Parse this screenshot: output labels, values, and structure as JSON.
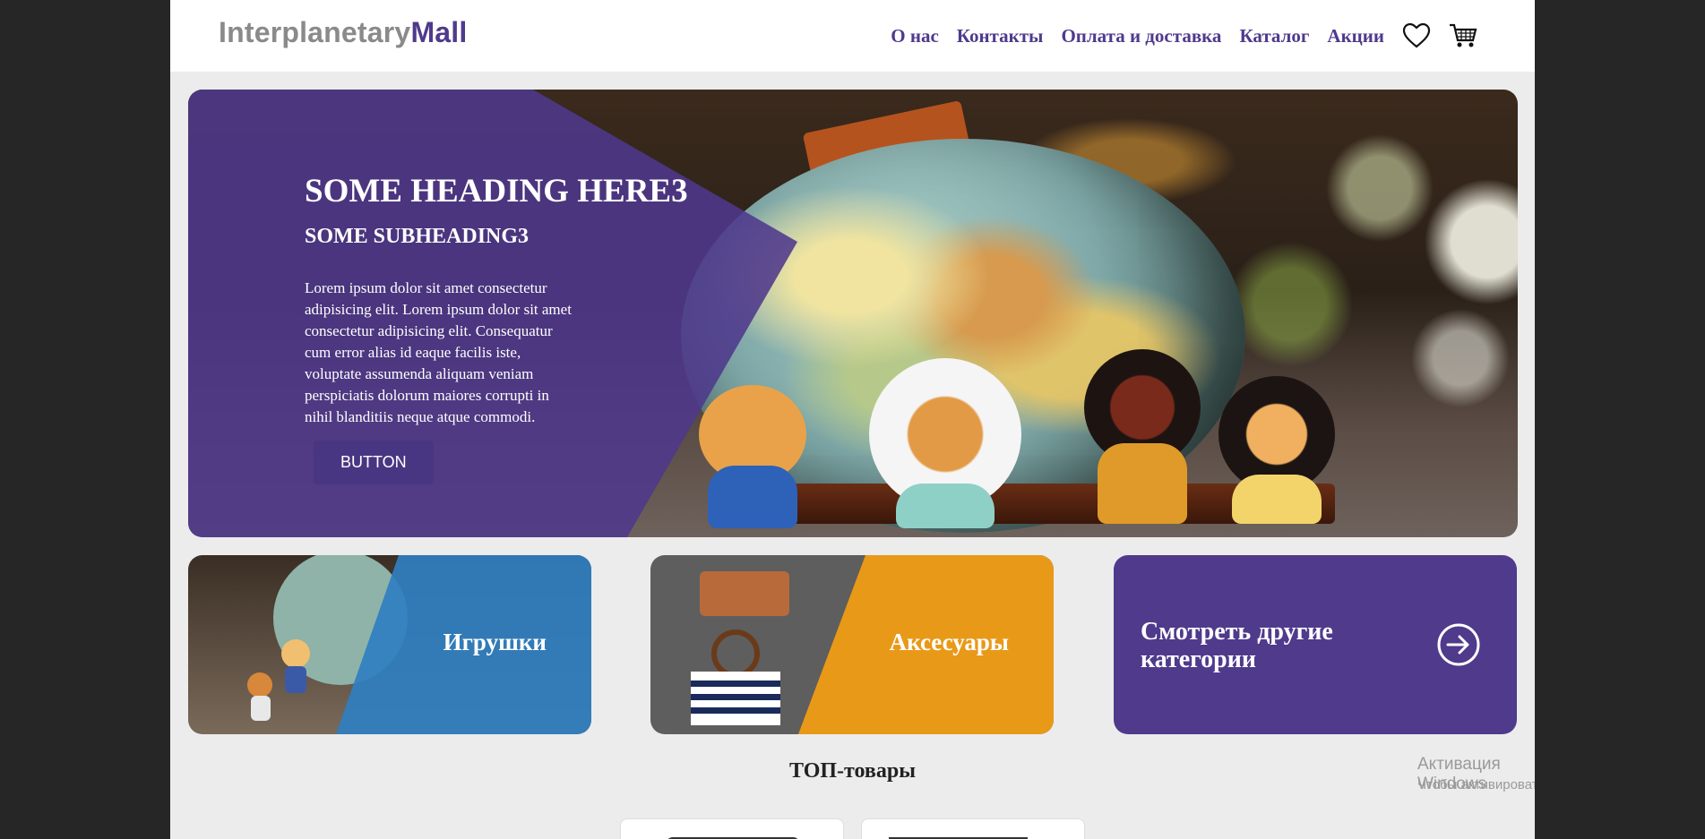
{
  "header": {
    "logo_part1": "Interplanetary",
    "logo_part2": "Mall",
    "nav": [
      "О нас",
      "Контакты",
      "Оплата и доставка",
      "Каталог",
      "Акции"
    ],
    "wishlist_icon": "heart-icon",
    "cart_icon": "cart-icon"
  },
  "hero": {
    "heading": "SOME HEADING HERE3",
    "subheading": "SOME SUBHEADING3",
    "text": "Lorem ipsum dolor sit amet consectetur adipisicing elit. Lorem ipsum dolor sit amet consectetur adipisicing elit. Consequatur cum error alias id eaque facilis iste, voluptate assumenda aliquam veniam perspiciatis dolorum maiores corrupti in nihil blanditiis neque atque commodi.",
    "button_label": "BUTTON"
  },
  "categories": [
    {
      "label": "Игрушки",
      "color": "#2f7fc1"
    },
    {
      "label": "Аксесуары",
      "color": "#f09c14"
    },
    {
      "label": "Смотреть другие категории",
      "color": "#4f3a8c",
      "icon": "arrow-right-circle-icon"
    }
  ],
  "top_products": {
    "title": "ТОП-товары"
  },
  "os_overlay": {
    "title": "Активация Windows",
    "subtitle": "Чтобы активировать Windows, перейдите в раздел \"Параметры\"."
  },
  "colors": {
    "brand": "#4f3a8c",
    "logo_gray": "#8a8a8a",
    "page_bg": "#ececec"
  }
}
